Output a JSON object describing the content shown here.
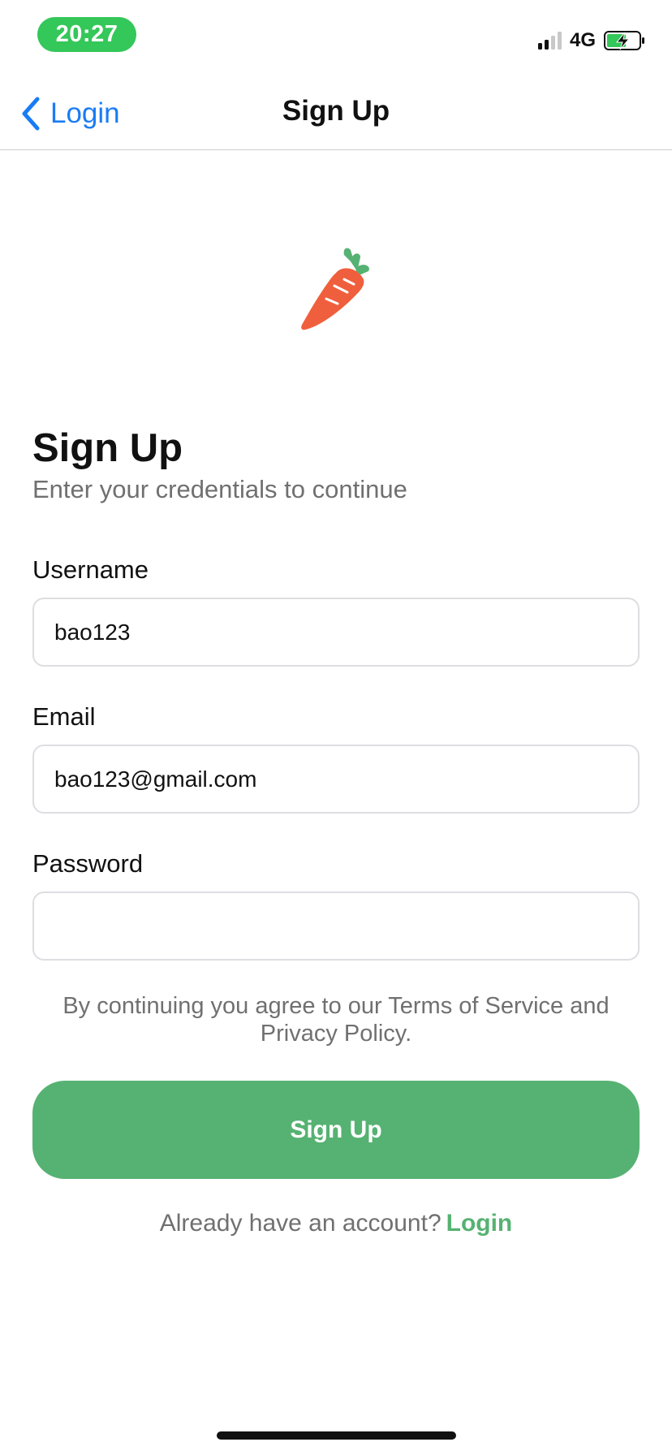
{
  "status_bar": {
    "time": "20:27",
    "network": "4G",
    "signal_icon": "cellular-signal-icon",
    "battery_icon": "battery-charging-icon",
    "time_pill_color": "#34c759"
  },
  "navbar": {
    "back_icon": "chevron-left-icon",
    "back_label": "Login",
    "title": "Sign Up",
    "accent_color": "#1a7cf5"
  },
  "logo": {
    "icon": "carrot-icon"
  },
  "main": {
    "heading": "Sign Up",
    "subheading": "Enter your credentials to continue"
  },
  "form": {
    "username_label": "Username",
    "username_value": "bao123",
    "email_label": "Email",
    "email_value": "bao123@gmail.com",
    "password_label": "Password",
    "password_value": ""
  },
  "terms": {
    "line1": "By continuing you agree to our Terms of Service and",
    "line2": "Privacy Policy."
  },
  "signup_button": {
    "label": "Sign Up",
    "color": "#56b272"
  },
  "footer": {
    "prompt": "Already have an account?",
    "login_link": "Login"
  }
}
